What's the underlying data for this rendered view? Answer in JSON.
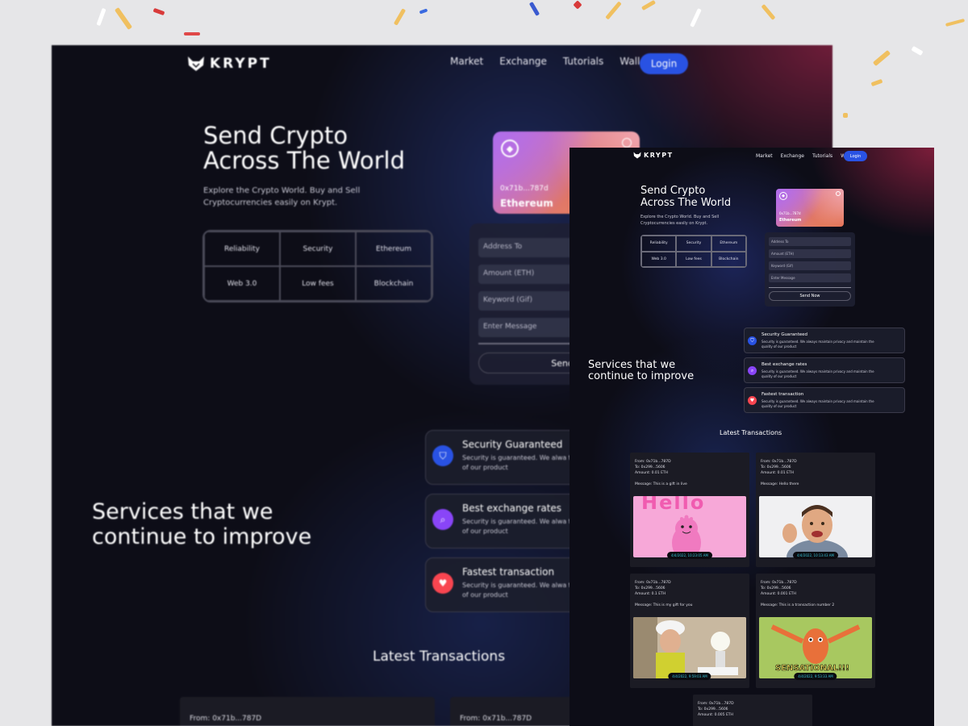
{
  "brand": {
    "name": "KRYPT"
  },
  "nav": {
    "links": [
      "Market",
      "Exchange",
      "Tutorials",
      "Wallets"
    ],
    "login_label": "Login"
  },
  "hero": {
    "title_line1": "Send Crypto",
    "title_line2": "Across The World",
    "subtitle": "Explore the Crypto World. Buy and Sell Cryptocurrencies easily on Krypt.",
    "features": [
      "Reliability",
      "Security",
      "Ethereum",
      "Web 3.0",
      "Low fees",
      "Blockchain"
    ]
  },
  "eth_card": {
    "address": "0x71b...787d",
    "network": "Ethereum",
    "icon": "ethereum-icon"
  },
  "send_form": {
    "address_placeholder": "Address To",
    "amount_placeholder": "Amount (ETH)",
    "keyword_placeholder": "Keyword (Gif)",
    "message_placeholder": "Enter Message",
    "send_label": "Send Now",
    "send_label_back": "Send N"
  },
  "services": {
    "title_line1": "Services that we",
    "title_line2": "continue to improve",
    "items": [
      {
        "title": "Security Guaranteed",
        "desc": "Security is guaranteed. We always maintain privacy and maintain the quality of our product",
        "desc_back": "Security is guaranteed. We alwa the quality of our product",
        "color": "#2952e3",
        "icon": "shield-icon"
      },
      {
        "title": "Best exchange rates",
        "desc": "Security is guaranteed. We always maintain privacy and maintain the quality of our product",
        "desc_back": "Security is guaranteed. We alwa the quality of our product",
        "color": "#8945f8",
        "icon": "search-icon"
      },
      {
        "title": "Fastest transaction",
        "desc": "Security is guaranteed. We always maintain privacy and maintain the quality of our product",
        "desc_back": "Security is guaranteed. We alwa the quality of our product",
        "color": "#f84550",
        "icon": "heart-icon"
      }
    ]
  },
  "transactions": {
    "title": "Latest Transactions",
    "items": [
      {
        "from": "From: 0x71b...787D",
        "to": "To: 0x299...5606",
        "amount": "Amount: 0.01 ETH",
        "message": "Message: This is a gift in live",
        "time": "4/4/2022, 10:23:05 AM",
        "gif_text": "Hello"
      },
      {
        "from": "From: 0x71b...787D",
        "to": "To: 0x299...5606",
        "amount": "Amount: 0.01 ETH",
        "message": "Message: Hello there",
        "time": "4/4/2022, 10:13:43 AM",
        "gif_text": ""
      },
      {
        "from": "From: 0x71b...787D",
        "to": "To: 0x299...5606",
        "amount": "Amount: 0.1 ETH",
        "message": "Message: This is my gift for you",
        "time": "4/4/2022, 9:59:03 AM",
        "gif_text": ""
      },
      {
        "from": "From: 0x71b...787D",
        "to": "To: 0x299...5606",
        "amount": "Amount: 0.001 ETH",
        "message": "Message: This is a transaction number 2",
        "time": "4/4/2022, 9:53:33 AM",
        "gif_text": "SENSATIONAL!!!"
      },
      {
        "from": "From: 0x71b...787D",
        "to": "To: 0x299...5606",
        "amount": "Amount: 0.005 ETH"
      }
    ],
    "back_from": "From: 0x71b...787D"
  },
  "colors": {
    "accent": "#2952e3",
    "background": "#0d0d17",
    "timestamp": "#37c7da"
  }
}
